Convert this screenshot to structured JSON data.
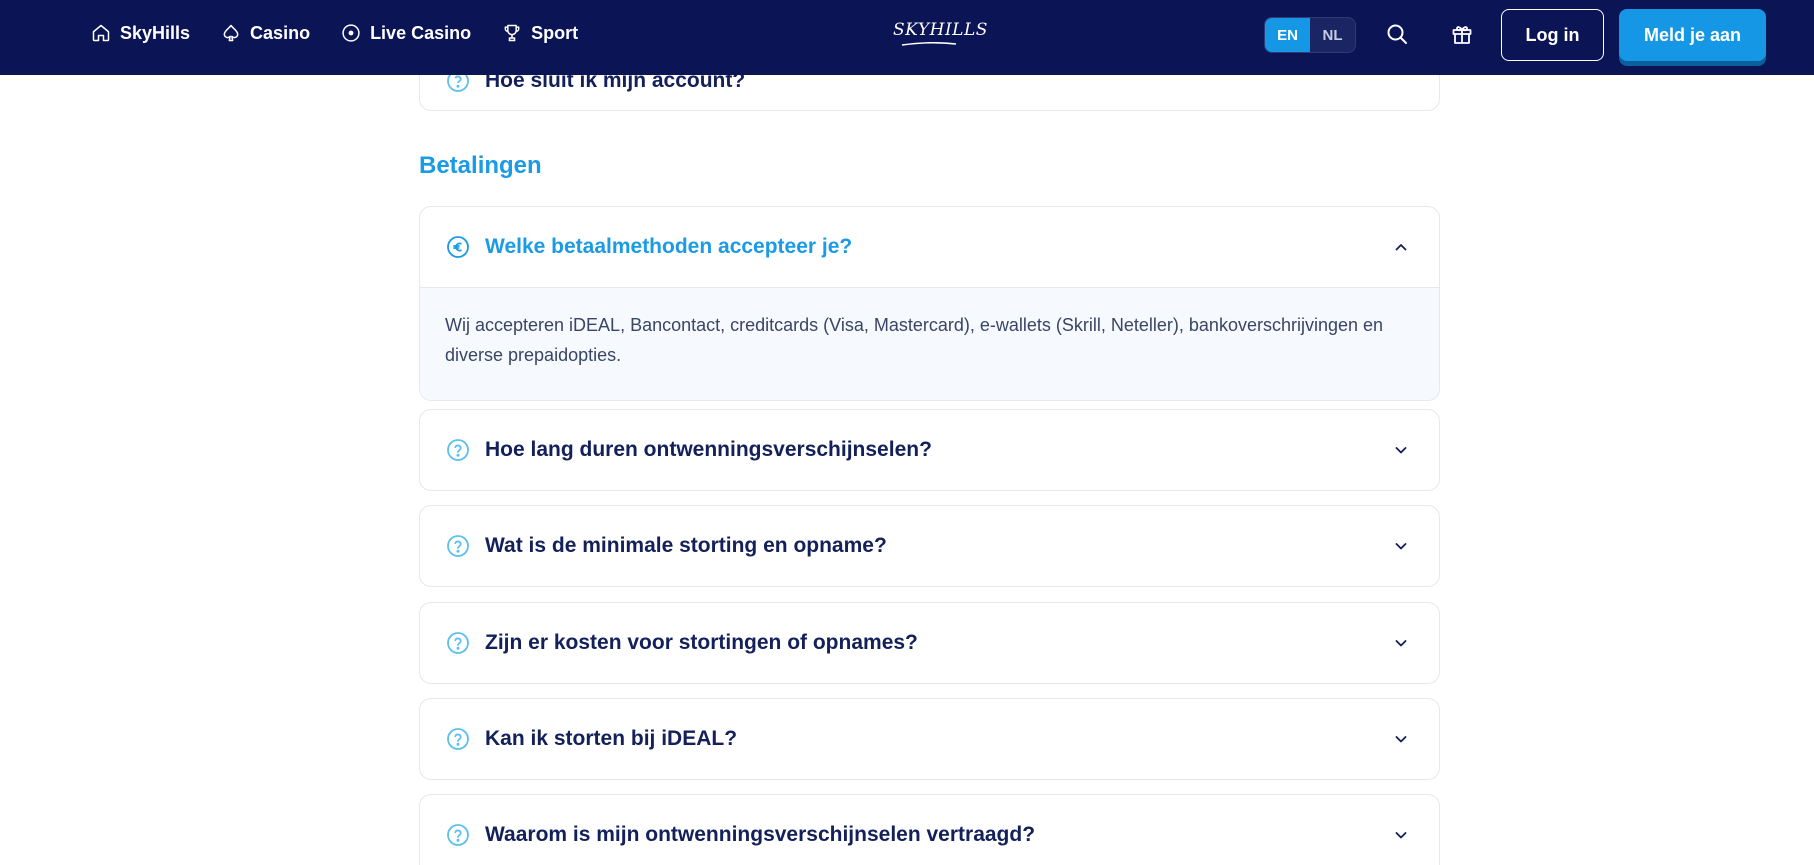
{
  "header": {
    "nav": [
      {
        "label": "SkyHills",
        "icon": "home-icon"
      },
      {
        "label": "Casino",
        "icon": "spade-icon"
      },
      {
        "label": "Live Casino",
        "icon": "play-circle-icon"
      },
      {
        "label": "Sport",
        "icon": "trophy-icon"
      }
    ],
    "logo": "SKYHILLS",
    "languages": [
      {
        "code": "EN",
        "active": true
      },
      {
        "code": "NL",
        "active": false
      }
    ],
    "login_label": "Log in",
    "signup_label": "Meld je aan"
  },
  "colors": {
    "header_bg": "#0b1556",
    "accent": "#1597e5",
    "heading": "#1b9be6",
    "text_dark": "#13205a"
  },
  "faq": {
    "partial_item": "Hoe sluit ik mijn account?",
    "section_title": "Betalingen",
    "items": [
      {
        "question": "Welke betaalmethoden accepteer je?",
        "icon": "euro-circle-icon",
        "open": true,
        "answer": "Wij accepteren iDEAL, Bancontact, creditcards (Visa, Mastercard), e-wallets (Skrill, Neteller), bankoverschrijvingen en diverse prepaidopties."
      },
      {
        "question": "Hoe lang duren ontwenningsverschijnselen?",
        "icon": "question-circle-icon",
        "open": false
      },
      {
        "question": "Wat is de minimale storting en opname?",
        "icon": "question-circle-icon",
        "open": false
      },
      {
        "question": "Zijn er kosten voor stortingen of opnames?",
        "icon": "question-circle-icon",
        "open": false
      },
      {
        "question": "Kan ik storten bij iDEAL?",
        "icon": "question-circle-icon",
        "open": false
      },
      {
        "question": "Waarom is mijn ontwenningsverschijnselen vertraagd?",
        "icon": "question-circle-icon",
        "open": false
      }
    ]
  }
}
